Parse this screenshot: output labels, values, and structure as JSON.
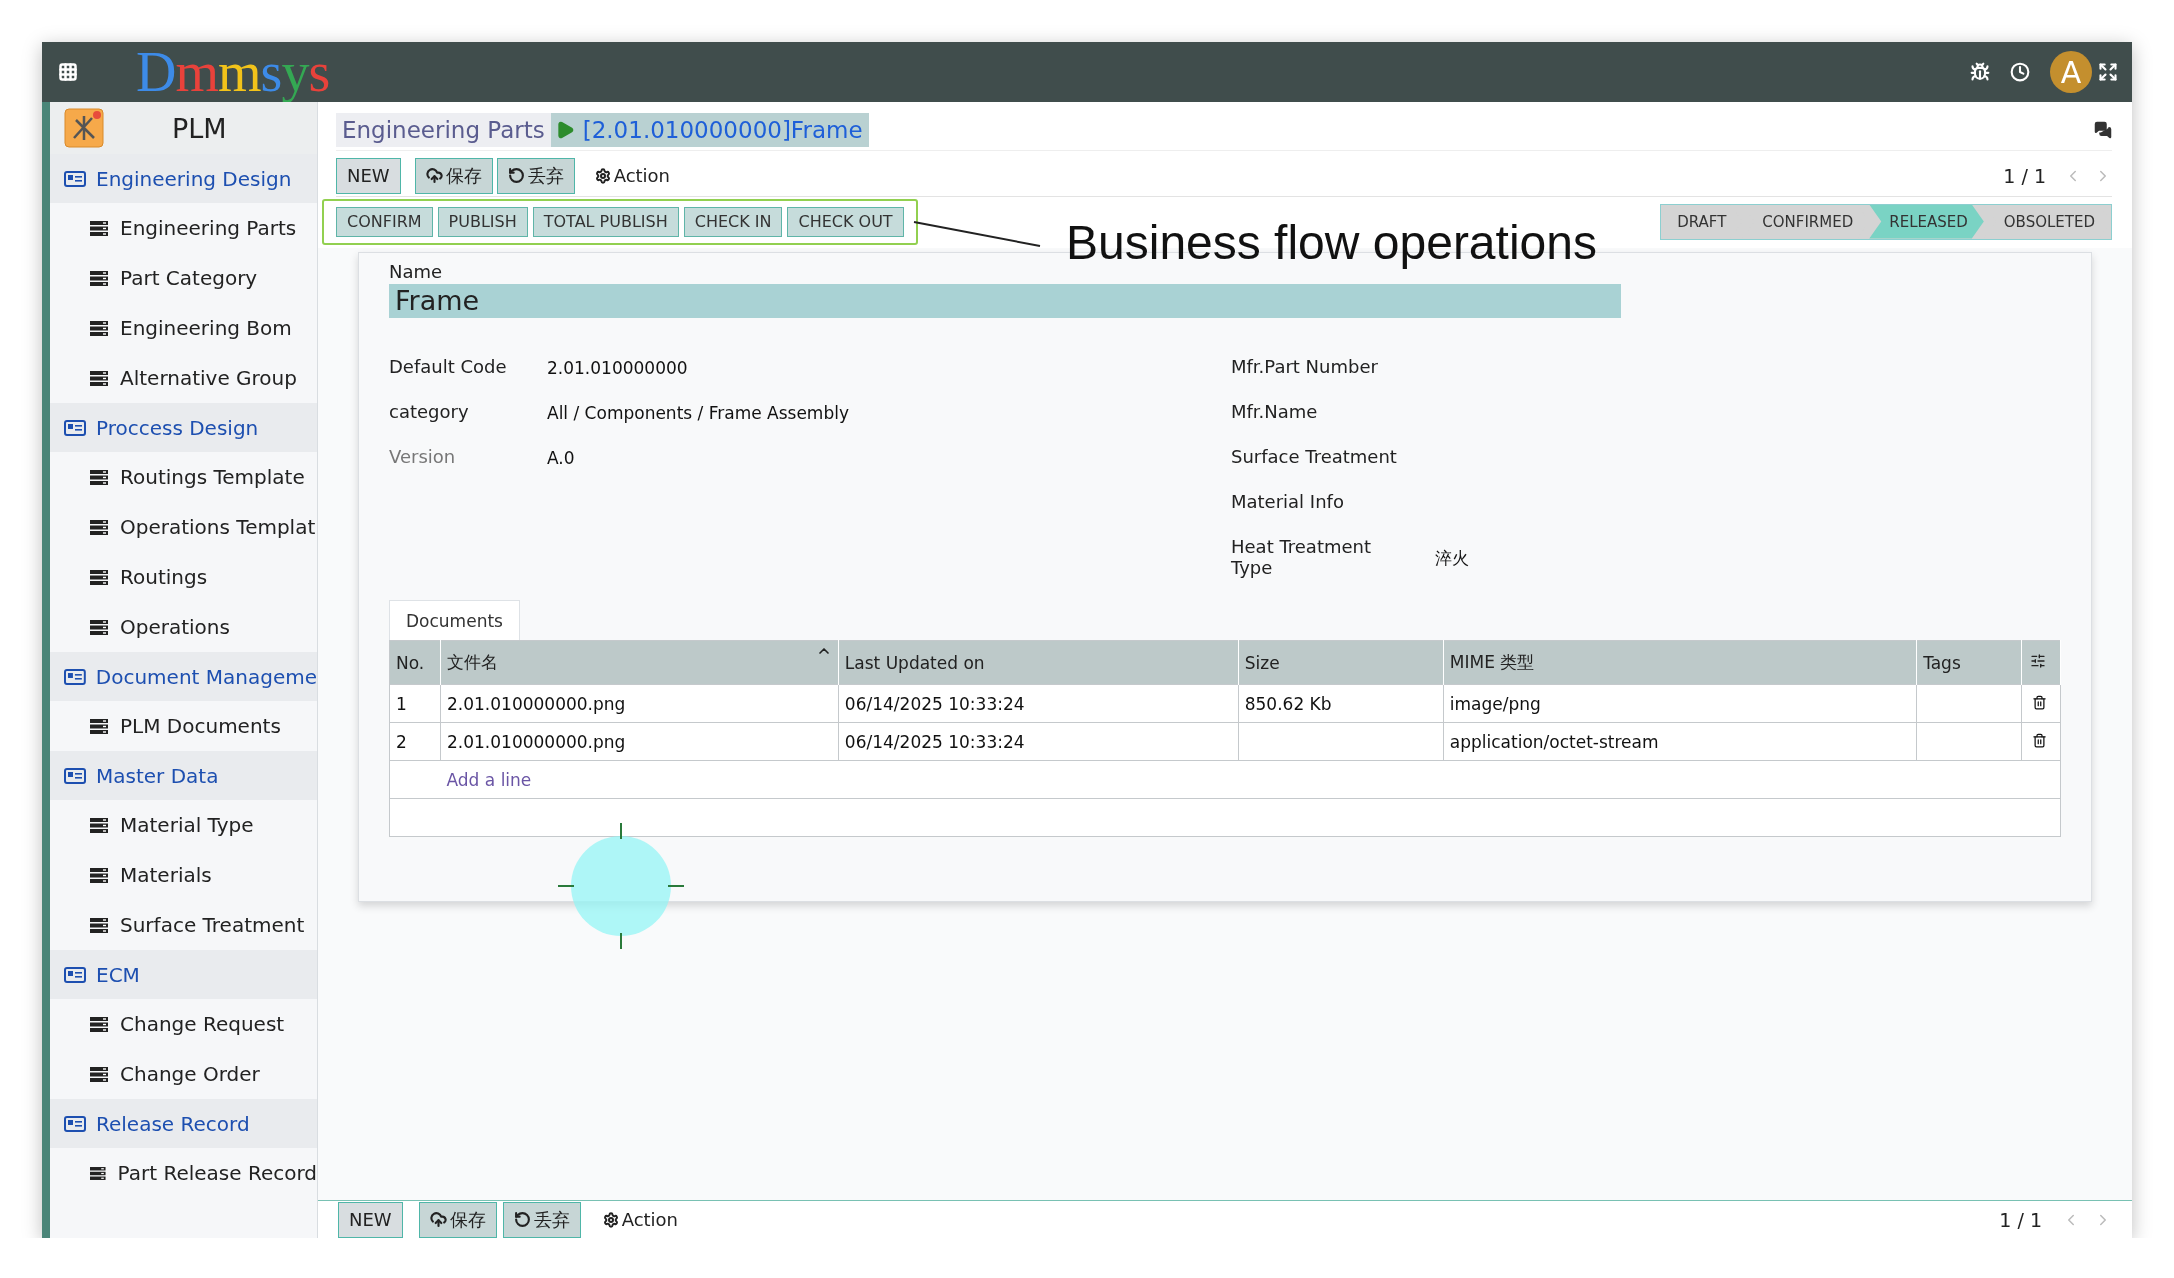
{
  "topbar": {
    "logo": "Dmmsys",
    "avatar": "A"
  },
  "sidebar": {
    "app": "PLM",
    "sections": [
      {
        "label": "Engineering Design",
        "children": [
          {
            "label": "Engineering Parts"
          },
          {
            "label": "Part Category"
          },
          {
            "label": "Engineering Bom"
          },
          {
            "label": "Alternative Group"
          }
        ]
      },
      {
        "label": "Proccess Design",
        "children": [
          {
            "label": "Routings Template"
          },
          {
            "label": "Operations Templat"
          },
          {
            "label": "Routings"
          },
          {
            "label": "Operations"
          }
        ]
      },
      {
        "label": "Document Manageme",
        "children": [
          {
            "label": "PLM Documents"
          }
        ]
      },
      {
        "label": "Master Data",
        "children": [
          {
            "label": "Material Type"
          },
          {
            "label": "Materials"
          },
          {
            "label": "Surface Treatment"
          }
        ]
      },
      {
        "label": "ECM",
        "children": [
          {
            "label": "Change Request"
          },
          {
            "label": "Change Order"
          }
        ]
      },
      {
        "label": "Release Record",
        "children": [
          {
            "label": "Part Release Record"
          }
        ]
      }
    ]
  },
  "breadcrumb": {
    "parent": "Engineering Parts",
    "current": "[2.01.010000000]Frame"
  },
  "toolbar": {
    "buttons": [
      {
        "label": "NEW",
        "kind": "new"
      },
      {
        "label": "保存",
        "kind": "save"
      },
      {
        "label": "丢弃",
        "kind": "discard"
      },
      {
        "label": "Action",
        "kind": "action"
      }
    ],
    "pager": "1 / 1"
  },
  "flow_buttons": [
    "CONFIRM",
    "PUBLISH",
    "TOTAL PUBLISH",
    "CHECK IN",
    "CHECK OUT"
  ],
  "annotation": "Business flow operations",
  "stages": [
    {
      "label": "DRAFT",
      "selected": false
    },
    {
      "label": "CONFIRMED",
      "selected": false
    },
    {
      "label": "RELEASED",
      "selected": true
    },
    {
      "label": "OBSOLETED",
      "selected": false
    }
  ],
  "form": {
    "name_label": "Name",
    "name": "Frame",
    "left_fields": [
      {
        "label": "Default Code",
        "value": "2.01.010000000",
        "muted": false
      },
      {
        "label": "category",
        "value": "All / Components / Frame Assembly",
        "muted": false
      },
      {
        "label": "Version",
        "value": "A.0",
        "muted": true
      }
    ],
    "right_fields": [
      {
        "label": "Mfr.Part Number"
      },
      {
        "label": "Mfr.Name"
      },
      {
        "label": "Surface Treatment"
      },
      {
        "label": "Material Info"
      },
      {
        "label": "Heat Treatment Type",
        "value": "淬火"
      }
    ]
  },
  "documents": {
    "tab": "Documents",
    "columns": [
      {
        "label": "No.",
        "sorted": false
      },
      {
        "label": "文件名",
        "sorted": true
      },
      {
        "label": "Last Updated on",
        "sorted": false
      },
      {
        "label": "Size",
        "sorted": false
      },
      {
        "label": "MIME 类型",
        "sorted": false
      },
      {
        "label": "Tags",
        "sorted": false
      }
    ],
    "rows": [
      [
        "1",
        "2.01.010000000.png",
        "06/14/2025 10:33:24",
        "850.62 Kb",
        "image/png",
        ""
      ],
      [
        "2",
        "2.01.010000000.png",
        "06/14/2025 10:33:24",
        "",
        "application/octet-stream",
        ""
      ]
    ],
    "add_line": "Add a line"
  },
  "bottom_bar": {
    "buttons": [
      {
        "label": "NEW",
        "kind": "new"
      },
      {
        "label": "保存",
        "kind": "save"
      },
      {
        "label": "丢弃",
        "kind": "discard"
      },
      {
        "label": "Action",
        "kind": "action"
      }
    ],
    "pager": "1 / 1"
  }
}
